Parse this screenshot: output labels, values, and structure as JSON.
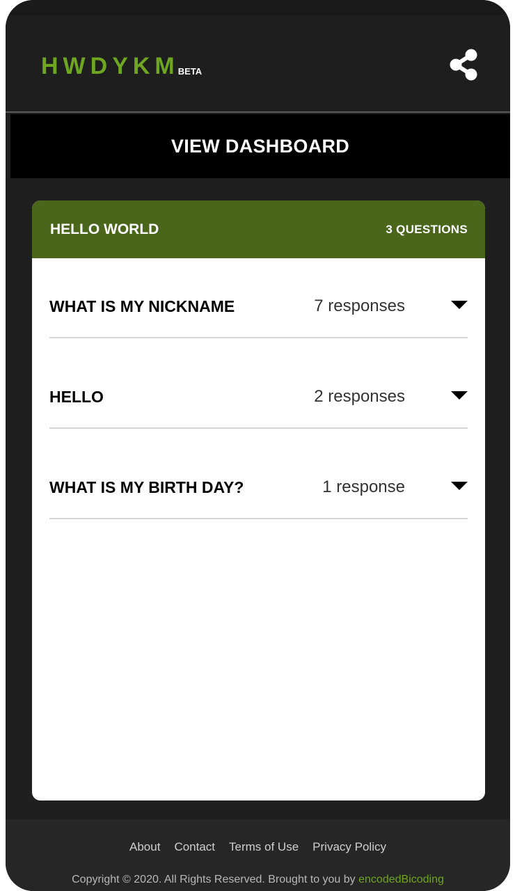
{
  "header": {
    "logo": "HWDYKM",
    "beta": "BETA",
    "share_icon": "share-icon"
  },
  "dashboard_button": "VIEW DASHBOARD",
  "card": {
    "title": "HELLO WORLD",
    "count": "3 QUESTIONS",
    "questions": [
      {
        "text": "WHAT IS MY NICKNAME",
        "responses": "7 responses"
      },
      {
        "text": "HELLO",
        "responses": "2 responses"
      },
      {
        "text": "WHAT IS MY BIRTH DAY?",
        "responses": "1 response"
      }
    ]
  },
  "footer": {
    "links": [
      "About",
      "Contact",
      "Terms of Use",
      "Privacy Policy"
    ],
    "copyright": "Copyright © 2020. All Rights Reserved. Brought to you by",
    "brand": "encodedBicoding"
  },
  "colors": {
    "accent": "#6ea521",
    "card_header": "#4a661b",
    "background": "#1f1f1f"
  }
}
